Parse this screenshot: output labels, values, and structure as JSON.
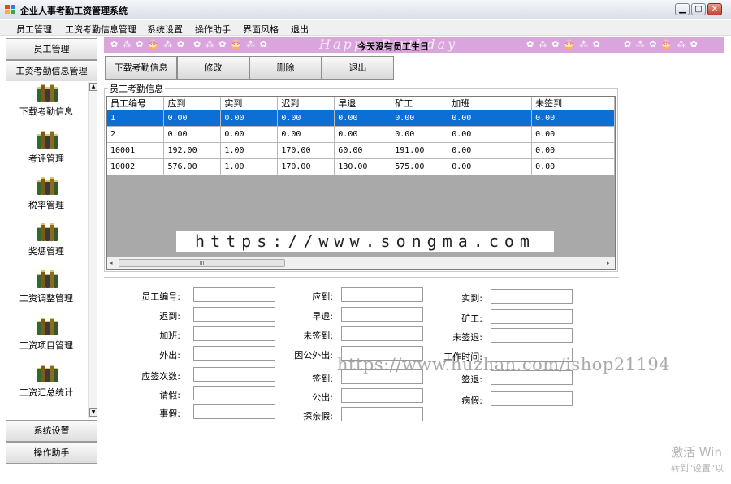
{
  "window": {
    "title": "企业人事考勤工资管理系统",
    "minimize_glyph": "▁",
    "maximize_glyph": "▢",
    "close_glyph": "✕"
  },
  "menu": [
    "员工管理",
    "工资考勤信息管理",
    "系统设置",
    "操作助手",
    "界面风格",
    "退出"
  ],
  "nav": {
    "top_buttons": [
      "员工管理",
      "工资考勤信息管理"
    ],
    "items": [
      "下载考勤信息",
      "考评管理",
      "税率管理",
      "奖惩管理",
      "工资调整管理",
      "工资项目管理",
      "工资汇总统计"
    ],
    "bottom_buttons": [
      "系统设置",
      "操作助手"
    ],
    "item_icon": "books-icon",
    "scroll_up": "▲",
    "scroll_down": "▼"
  },
  "banner": {
    "script_text": "Happy Birthday",
    "notice": "今天没有员工生日",
    "decor": "✿ ⁂ ✿ 🎂 ⁂ ✿"
  },
  "toolbar": [
    "下载考勤信息",
    "修改",
    "删除",
    "退出"
  ],
  "group_title": "员工考勤信息",
  "table": {
    "columns": [
      "员工编号",
      "应到",
      "实到",
      "迟到",
      "早退",
      "矿工",
      "加班",
      "未签到"
    ],
    "rows": [
      [
        "1",
        "0.00",
        "0.00",
        "0.00",
        "0.00",
        "0.00",
        "0.00",
        "0.00"
      ],
      [
        "2",
        "0.00",
        "0.00",
        "0.00",
        "0.00",
        "0.00",
        "0.00",
        "0.00"
      ],
      [
        "10001",
        "192.00",
        "1.00",
        "170.00",
        "60.00",
        "191.00",
        "0.00",
        "0.00"
      ],
      [
        "10002",
        "576.00",
        "1.00",
        "170.00",
        "130.00",
        "575.00",
        "0.00",
        "0.00"
      ]
    ],
    "selected_row": 0,
    "scroll_thumb": "III",
    "scroll_left": "◂",
    "scroll_right": "▸"
  },
  "form": {
    "col1": [
      "员工编号:",
      "迟到:",
      "加班:",
      "外出:",
      "应签次数:",
      "请假:",
      "事假:"
    ],
    "col2": [
      "应到:",
      "早退:",
      "未签到:",
      "因公外出:",
      "签到:",
      "公出:",
      "探亲假:"
    ],
    "col3": [
      "实到:",
      "矿工:",
      "未签退:",
      "工作时间:",
      "签退:",
      "病假:"
    ]
  },
  "watermarks": {
    "url1": "https://www.songma.com",
    "url2": "https://www.huzhan.com/ishop21194"
  },
  "os_notice": {
    "line1": "激活 Win",
    "line2": "转到\"设置\"以"
  },
  "colors": {
    "selection": "#0b6fd6",
    "banner": "#d9a5dc",
    "grid_background": "#a9a9a9"
  }
}
